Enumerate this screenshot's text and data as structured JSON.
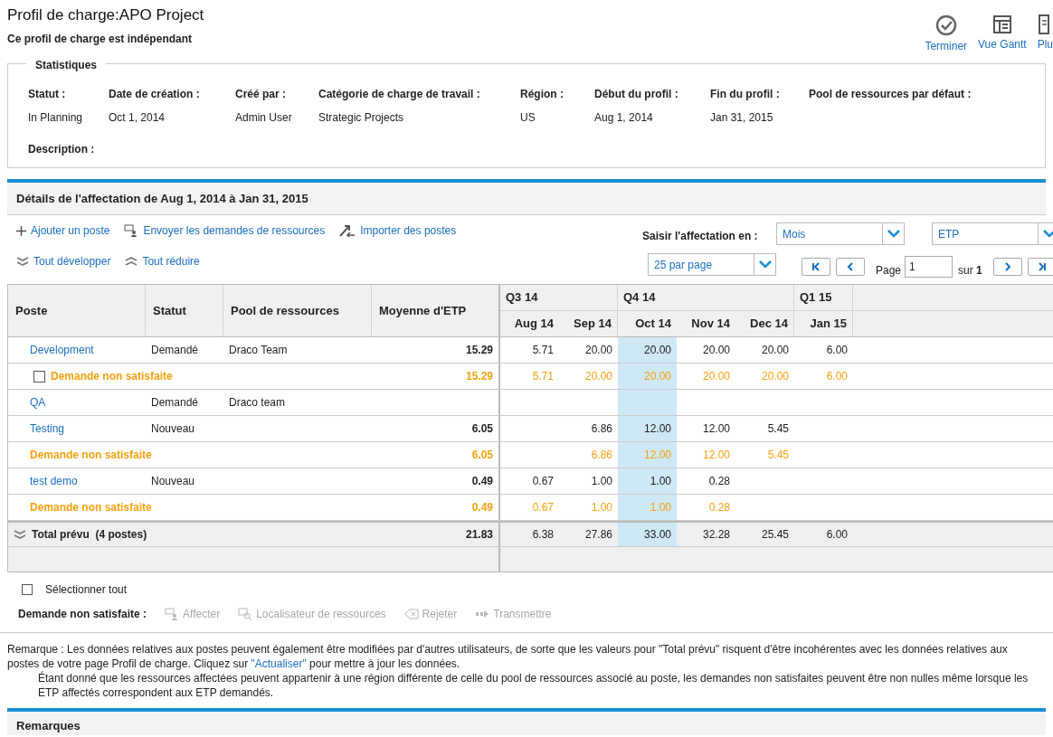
{
  "page": {
    "title": "Profil de charge:APO Project",
    "subtitle": "Ce profil de charge est indépendant"
  },
  "toolbar": [
    {
      "kind": "check",
      "label": "Terminer"
    },
    {
      "kind": "gantt",
      "label": "Vue Gantt"
    },
    {
      "kind": "doc",
      "label": "Plu"
    }
  ],
  "statistics": {
    "legend": "Statistiques",
    "fields": [
      {
        "label": "Statut :",
        "value": "In Planning"
      },
      {
        "label": "Date de création :",
        "value": "Oct 1, 2014"
      },
      {
        "label": "Créé par :",
        "value": "Admin User"
      },
      {
        "label": "Catégorie de charge de travail :",
        "value": "Strategic Projects"
      },
      {
        "label": "Région :",
        "value": "US"
      },
      {
        "label": "Début du profil :",
        "value": "Aug 1, 2014"
      },
      {
        "label": "Fin du profil :",
        "value": "Jan 31, 2015"
      },
      {
        "label": "Pool de ressources par défaut :"
      }
    ],
    "description_label": "Description :"
  },
  "details": {
    "title": "Détails de l'affectation de Aug 1, 2014 à Jan 31, 2015",
    "actions": [
      {
        "kind": "plus",
        "label": "Ajouter un poste"
      },
      {
        "kind": "send",
        "label": "Envoyer les demandes de ressources"
      },
      {
        "kind": "import",
        "label": "Importer des postes"
      }
    ],
    "actions_2": [
      {
        "kind": "expand",
        "label": "Tout développer"
      },
      {
        "kind": "collapse",
        "label": "Tout réduire"
      }
    ],
    "entry_label": "Saisir l'affectation en :",
    "period_select": "Mois",
    "unit_select": "ETP",
    "page_size_select": "25 par page",
    "pager": {
      "page_label": "Page",
      "page_value": "1",
      "of_label": "sur",
      "total": "1"
    }
  },
  "table": {
    "columns": [
      "Poste",
      "Statut",
      "Pool de ressources",
      "Moyenne d'ETP"
    ],
    "quarters": [
      {
        "label": "Q3 14",
        "months": [
          {
            "label": "Aug 14",
            "highlighted": false
          },
          {
            "label": "Sep 14",
            "highlighted": false
          }
        ]
      },
      {
        "label": "Q4 14",
        "months": [
          {
            "label": "Oct 14",
            "highlighted": true
          },
          {
            "label": "Nov 14",
            "highlighted": false
          },
          {
            "label": "Dec 14",
            "highlighted": false
          }
        ]
      },
      {
        "label": "Q1 15",
        "months": [
          {
            "label": "Jan 15",
            "highlighted": false
          }
        ]
      }
    ],
    "rows": [
      {
        "kind": "position",
        "name": "Development",
        "status": "Demandé",
        "pool": "Draco Team",
        "average": "15.29",
        "months": [
          "5.71",
          "20.00",
          "20.00",
          "20.00",
          "20.00",
          "6.00"
        ]
      },
      {
        "kind": "selectable",
        "checked": false,
        "name": "Demande non satisfaite",
        "average": "15.29",
        "months": [
          "5.71",
          "20.00",
          "20.00",
          "20.00",
          "20.00",
          "6.00"
        ]
      },
      {
        "kind": "position",
        "name": "QA",
        "status": "Demandé",
        "pool": "Draco team",
        "months": [
          {
            "kind": "empty"
          },
          {
            "kind": "empty"
          },
          {
            "kind": "empty"
          },
          {
            "kind": "empty"
          },
          {
            "kind": "empty"
          },
          {
            "kind": "empty"
          }
        ]
      },
      {
        "kind": "position",
        "name": "Testing",
        "status": "Nouveau",
        "average": "6.05",
        "months": [
          {
            "kind": "empty"
          },
          "6.86",
          "12.00",
          "12.00",
          "5.45",
          {
            "kind": "empty"
          }
        ]
      },
      {
        "kind": "unmet",
        "name": "Demande non satisfaite",
        "average": "6.05",
        "months": [
          {
            "kind": "empty"
          },
          "6.86",
          "12.00",
          "12.00",
          "5.45",
          {
            "kind": "empty"
          }
        ]
      },
      {
        "kind": "position",
        "name": "test demo",
        "status": "Nouveau",
        "average": "0.49",
        "months": [
          "0.67",
          "1.00",
          "1.00",
          "0.28",
          {
            "kind": "empty"
          },
          {
            "kind": "empty"
          }
        ]
      },
      {
        "kind": "unmet",
        "name": "Demande non satisfaite",
        "average": "0.49",
        "months": [
          "0.67",
          "1.00",
          "1.00",
          "0.28",
          {
            "kind": "empty"
          },
          {
            "kind": "empty"
          }
        ]
      }
    ],
    "total": {
      "label": "Total prévu  (4 postes)",
      "average": "21.83",
      "months": [
        "6.38",
        "27.86",
        "33.00",
        "32.28",
        "25.45",
        "6.00"
      ]
    }
  },
  "select_all": {
    "label": "Sélectionner tout",
    "checked": false
  },
  "unmet_actions": {
    "label": "Demande non satisfaite :",
    "items": [
      {
        "kind": "assign",
        "label": "Affecter",
        "disabled": true
      },
      {
        "kind": "locate",
        "label": "Localisateur de ressources",
        "disabled": true
      },
      {
        "kind": "reject",
        "label": "Rejeter",
        "disabled": true
      },
      {
        "kind": "forward",
        "label": "Transmettre",
        "disabled": true
      }
    ]
  },
  "note": {
    "before": "Remarque : Les données relatives aux postes peuvent également être modifiées par d'autres utilisateurs, de sorte que les valeurs pour \"Total prévu\" risquent d'être incohérentes avec les données relatives aux postes de votre page Profil de charge. Cliquez sur ",
    "link": "\"Actualiser\"",
    "after": " pour mettre à jour les données.",
    "second": "Étant donné que les ressources affectées peuvent appartenir à une région différente de celle du pool de ressources associé au poste, les demandes non satisfaites peuvent être non nulles même lorsque les ETP affectés correspondent aux ETP demandés."
  },
  "remarks": {
    "title": "Remarques"
  }
}
